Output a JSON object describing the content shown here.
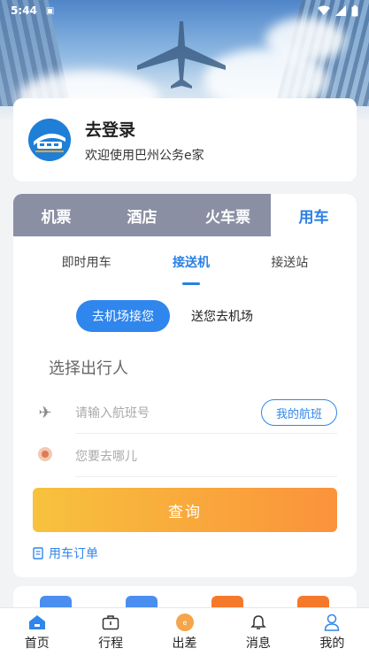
{
  "status_bar": {
    "time": "5:44"
  },
  "login": {
    "title": "去登录",
    "subtitle": "欢迎使用巴州公务e家"
  },
  "booking": {
    "tabs": [
      {
        "label": "机票",
        "active": false
      },
      {
        "label": "酒店",
        "active": false
      },
      {
        "label": "火车票",
        "active": false
      },
      {
        "label": "用车",
        "active": true
      }
    ],
    "subtabs": [
      {
        "label": "即时用车",
        "active": false
      },
      {
        "label": "接送机",
        "active": true
      },
      {
        "label": "接送站",
        "active": false
      }
    ],
    "modes": [
      {
        "label": "去机场接您",
        "active": true
      },
      {
        "label": "送您去机场",
        "active": false
      }
    ],
    "traveler_placeholder": "选择出行人",
    "flight_placeholder": "请输入航班号",
    "my_flight_label": "我的航班",
    "destination_placeholder": "您要去哪儿",
    "query_label": "查询",
    "orders_label": "用车订单"
  },
  "bottom_nav": [
    {
      "label": "首页",
      "icon": "home-icon"
    },
    {
      "label": "行程",
      "icon": "suitcase-icon"
    },
    {
      "label": "出差",
      "icon": "business-trip-icon"
    },
    {
      "label": "消息",
      "icon": "bell-icon"
    },
    {
      "label": "我的",
      "icon": "user-icon"
    }
  ],
  "colors": {
    "accent": "#2f86ec",
    "tab_bar": "#8a8fa3",
    "query_start": "#f7c23d",
    "query_end": "#fb923c"
  }
}
